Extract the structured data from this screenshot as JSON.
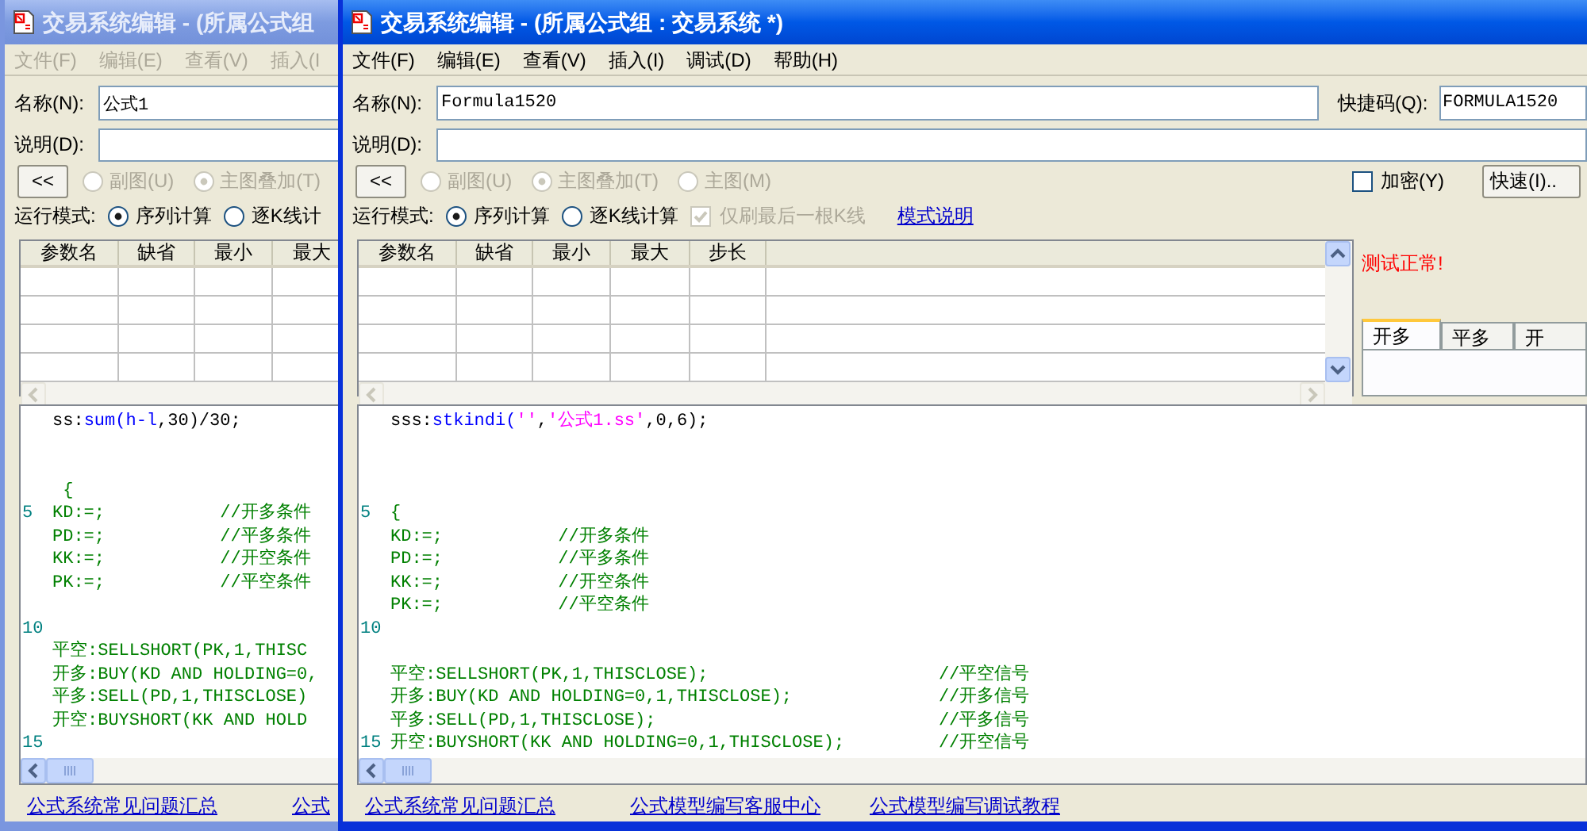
{
  "windows": [
    {
      "title": "交易系统编辑 - (所属公式组",
      "active": false,
      "menu": [
        "文件(F)",
        "编辑(E)",
        "查看(V)",
        "插入(I"
      ],
      "name_label": "名称(N):",
      "name_value": "公式1",
      "desc_label": "说明(D):",
      "collapse_button": "<<",
      "chart_options": [
        {
          "label": "副图(U)",
          "selected": false,
          "disabled": true
        },
        {
          "label": "主图叠加(T)",
          "selected": true,
          "disabled": true
        }
      ],
      "run_mode_label": "运行模式:",
      "run_modes": [
        {
          "label": "序列计算",
          "selected": true,
          "disabled": false
        },
        {
          "label": "逐K线计",
          "selected": false,
          "disabled": false
        }
      ],
      "param_columns": [
        "参数名",
        "缺省",
        "最小",
        "最大"
      ],
      "code_lines": [
        {
          "kind": "code",
          "parts": [
            {
              "kind": "plain",
              "text": "ss:"
            },
            {
              "kind": "function",
              "text": "sum(h-l"
            },
            {
              "kind": "plain",
              "text": ",30)/30;"
            }
          ]
        },
        {
          "kind": "blank"
        },
        {
          "kind": "blank"
        },
        {
          "kind": "code",
          "parts": [
            {
              "kind": "code",
              "text": " {"
            }
          ]
        },
        {
          "kind": "code",
          "gutter": "5",
          "parts": [
            {
              "kind": "code",
              "text": "KD:=;           //开多条件"
            }
          ]
        },
        {
          "kind": "code",
          "parts": [
            {
              "kind": "code",
              "text": "PD:=;           //平多条件"
            }
          ]
        },
        {
          "kind": "code",
          "parts": [
            {
              "kind": "code",
              "text": "KK:=;           //开空条件"
            }
          ]
        },
        {
          "kind": "code",
          "parts": [
            {
              "kind": "code",
              "text": "PK:=;           //平空条件"
            }
          ]
        },
        {
          "kind": "blank"
        },
        {
          "kind": "blank",
          "gutter": "10"
        },
        {
          "kind": "code",
          "parts": [
            {
              "kind": "code",
              "text": "平空:SELLSHORT(PK,1,THISC"
            }
          ]
        },
        {
          "kind": "code",
          "parts": [
            {
              "kind": "code",
              "text": "开多:BUY(KD AND HOLDING=0,"
            }
          ]
        },
        {
          "kind": "code",
          "parts": [
            {
              "kind": "code",
              "text": "平多:SELL(PD,1,THISCLOSE)"
            }
          ]
        },
        {
          "kind": "code",
          "parts": [
            {
              "kind": "code",
              "text": "开空:BUYSHORT(KK AND HOLD"
            }
          ]
        },
        {
          "kind": "blank",
          "gutter": "15"
        }
      ],
      "links": [
        "公式系统常见问题汇总",
        "公式"
      ]
    },
    {
      "title": "交易系统编辑 - (所属公式组 : 交易系统 *)",
      "active": true,
      "menu": [
        "文件(F)",
        "编辑(E)",
        "查看(V)",
        "插入(I)",
        "调试(D)",
        "帮助(H)"
      ],
      "name_label": "名称(N):",
      "name_value": "Formula1520",
      "shortcut_label": "快捷码(Q):",
      "shortcut_value": "FORMULA1520",
      "desc_label": "说明(D):",
      "collapse_button": "<<",
      "chart_options": [
        {
          "label": "副图(U)",
          "selected": false,
          "disabled": true
        },
        {
          "label": "主图叠加(T)",
          "selected": true,
          "disabled": true
        },
        {
          "label": "主图(M)",
          "selected": false,
          "disabled": true
        }
      ],
      "encrypt": {
        "label": "加密(Y)",
        "checked": false,
        "disabled": false
      },
      "quick_button": "快速(I)..",
      "run_mode_label": "运行模式:",
      "run_modes": [
        {
          "label": "序列计算",
          "selected": true,
          "disabled": false
        },
        {
          "label": "逐K线计算",
          "selected": false,
          "disabled": false
        }
      ],
      "refresh_last_bar": {
        "label": "仅刷最后一根K线",
        "checked": true,
        "disabled": true
      },
      "mode_link": "模式说明",
      "param_columns": [
        "参数名",
        "缺省",
        "最小",
        "最大",
        "步长"
      ],
      "status": "测试正常!",
      "tabs": [
        {
          "label": "开多",
          "selected": true
        },
        {
          "label": "平多",
          "selected": false
        },
        {
          "label": "开",
          "selected": false
        }
      ],
      "code_lines": [
        {
          "kind": "code",
          "parts": [
            {
              "kind": "plain",
              "text": "sss:"
            },
            {
              "kind": "function",
              "text": "stkindi("
            },
            {
              "kind": "string",
              "text": "''"
            },
            {
              "kind": "plain",
              "text": ","
            },
            {
              "kind": "string",
              "text": "'公式1.ss'"
            },
            {
              "kind": "plain",
              "text": ",0,6);"
            }
          ]
        },
        {
          "kind": "blank"
        },
        {
          "kind": "blank"
        },
        {
          "kind": "blank"
        },
        {
          "kind": "code",
          "gutter": "5",
          "parts": [
            {
              "kind": "code",
              "text": "{"
            }
          ]
        },
        {
          "kind": "code",
          "parts": [
            {
              "kind": "code",
              "text": "KD:=;           //开多条件"
            }
          ]
        },
        {
          "kind": "code",
          "parts": [
            {
              "kind": "code",
              "text": "PD:=;           //平多条件"
            }
          ]
        },
        {
          "kind": "code",
          "parts": [
            {
              "kind": "code",
              "text": "KK:=;           //开空条件"
            }
          ]
        },
        {
          "kind": "code",
          "parts": [
            {
              "kind": "code",
              "text": "PK:=;           //平空条件"
            }
          ]
        },
        {
          "kind": "blank",
          "gutter": "10"
        },
        {
          "kind": "blank"
        },
        {
          "kind": "code",
          "parts": [
            {
              "kind": "code",
              "text": "平空:SELLSHORT(PK,1,THISCLOSE);                      //平空信号"
            }
          ]
        },
        {
          "kind": "code",
          "parts": [
            {
              "kind": "code",
              "text": "开多:BUY(KD AND HOLDING=0,1,THISCLOSE);              //开多信号"
            }
          ]
        },
        {
          "kind": "code",
          "parts": [
            {
              "kind": "code",
              "text": "平多:SELL(PD,1,THISCLOSE);                           //平多信号"
            }
          ]
        },
        {
          "kind": "code",
          "gutter": "15",
          "parts": [
            {
              "kind": "code",
              "text": "开空:BUYSHORT(KK AND HOLDING=0,1,THISCLOSE);         //开空信号"
            }
          ]
        }
      ],
      "links": [
        "公式系统常见问题汇总",
        "公式模型编写客服中心",
        "公式模型编写调试教程"
      ]
    }
  ]
}
